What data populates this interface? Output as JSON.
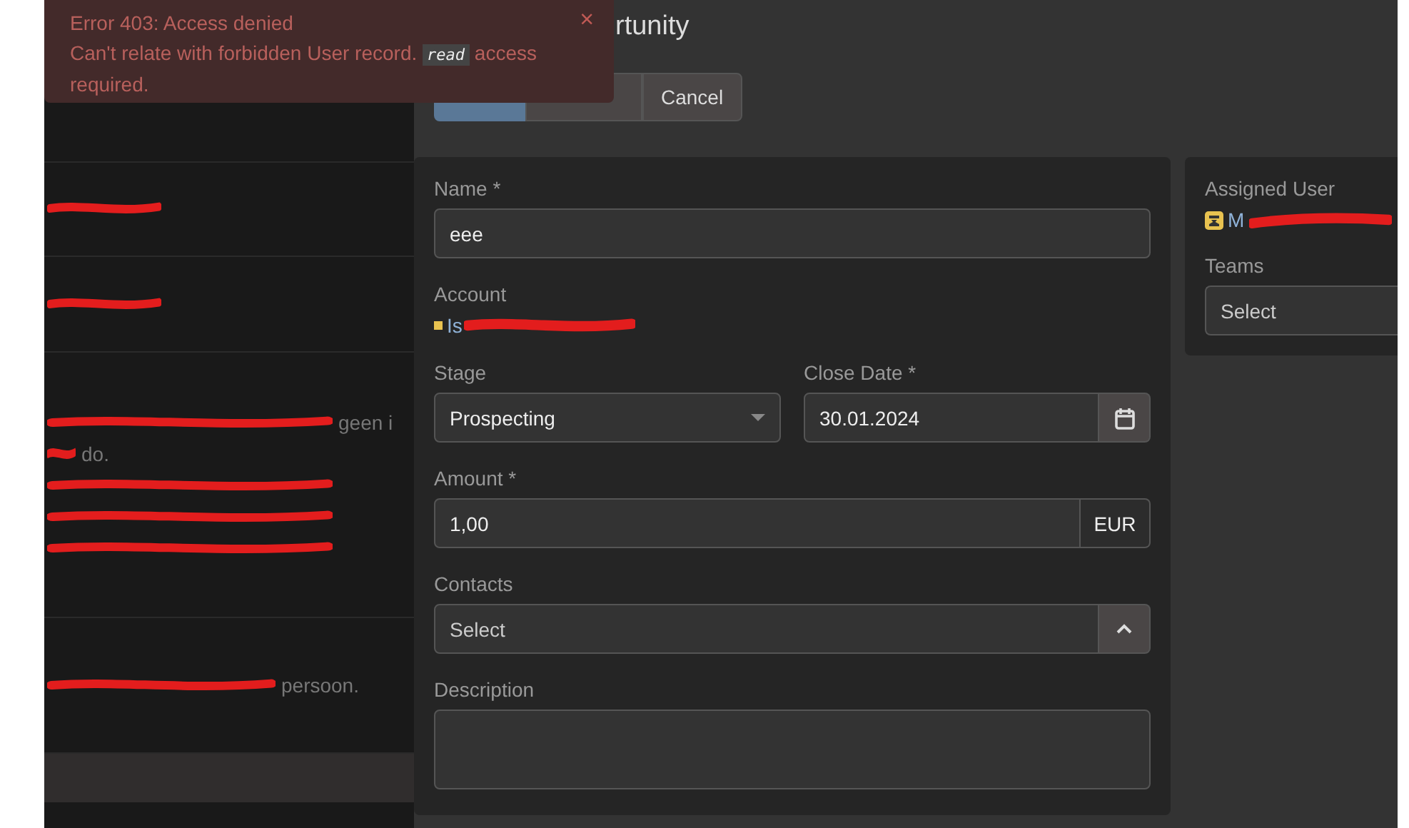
{
  "toast": {
    "title": "Error 403: Access denied",
    "message_before": "Can't relate with forbidden User record.",
    "code": "read",
    "message_after": "access required.",
    "close": "×"
  },
  "list": {
    "rows": [
      {
        "lines": [
          {
            "redacted": true
          }
        ]
      },
      {
        "lines": [
          {
            "redacted": true
          }
        ]
      },
      {
        "lines": [
          {
            "redacted": true,
            "text": "geen i"
          },
          {
            "redacted": true,
            "text": "do."
          },
          {
            "redacted": true
          },
          {
            "redacted": true
          },
          {
            "redacted": true
          }
        ]
      },
      {
        "lines": [
          {
            "redacted": true,
            "text": "persoon."
          }
        ]
      }
    ]
  },
  "header": {
    "title": "rtunity"
  },
  "buttons": [
    {
      "kind": "primary"
    },
    {
      "kind": "default"
    },
    {
      "label": "Cancel",
      "kind": "default"
    }
  ],
  "form": {
    "name": {
      "label": "Name *",
      "value": "eee"
    },
    "account": {
      "label": "Account",
      "value": "Is",
      "redacted": true
    },
    "stage": {
      "label": "Stage",
      "value": "Prospecting"
    },
    "close_date": {
      "label": "Close Date *",
      "value": "30.01.2024"
    },
    "amount": {
      "label": "Amount *",
      "value": "1,00",
      "currency": "EUR"
    },
    "contacts": {
      "label": "Contacts",
      "placeholder": "Select"
    },
    "description": {
      "label": "Description"
    }
  },
  "side": {
    "assigned_user": {
      "label": "Assigned User",
      "value": "M",
      "redacted": true
    },
    "teams": {
      "label": "Teams",
      "placeholder": "Select"
    }
  }
}
